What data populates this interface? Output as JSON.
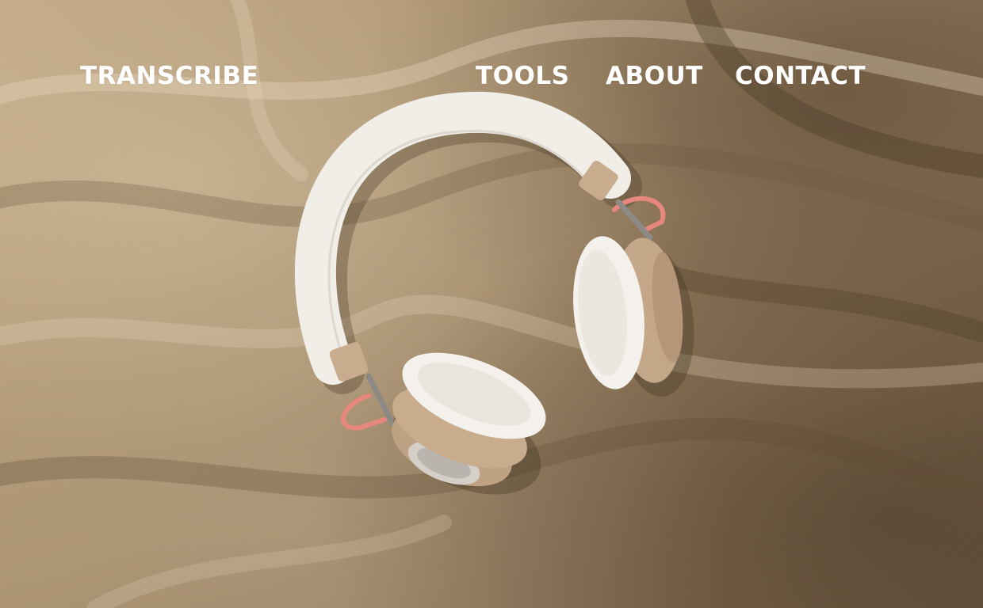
{
  "nav": {
    "brand": "TRANSCRIBE",
    "items": [
      {
        "label": "TOOLS"
      },
      {
        "label": "ABOUT"
      },
      {
        "label": "CONTACT"
      }
    ]
  },
  "hero": {
    "image_subject": "headphones-icon",
    "colors": {
      "fabric": "#a68e6f",
      "headband": "#f2efe9",
      "tan_accent": "#c7a88a",
      "pink_cable": "#e8877d",
      "nav_text": "#ffffff"
    }
  }
}
